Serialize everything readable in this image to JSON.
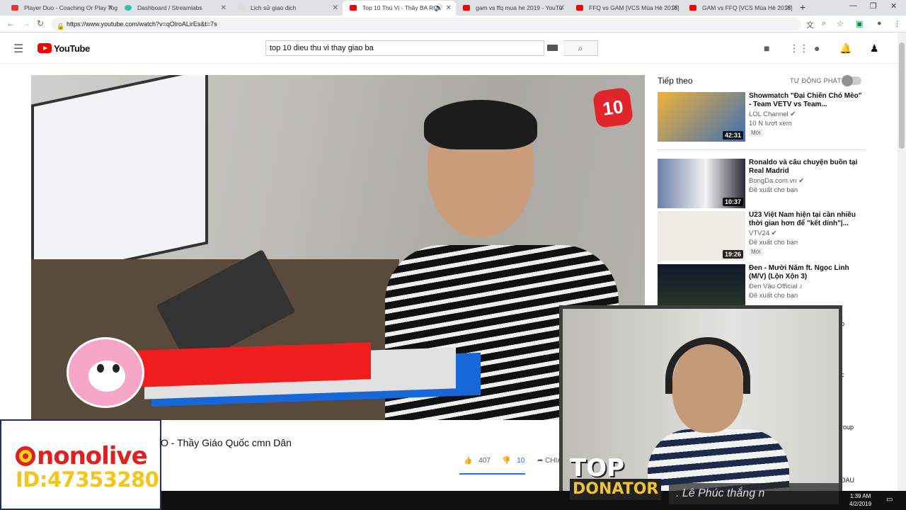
{
  "browser": {
    "tabs": [
      {
        "label": "Player Duo - Coaching Or Play Tog",
        "icon": "playerduo-icon",
        "color": "#e33"
      },
      {
        "label": "Dashboard / Streamlabs",
        "icon": "streamlabs-icon",
        "color": "#31c3a2"
      },
      {
        "label": "Lịch sử giao dịch",
        "icon": "page-icon",
        "color": "#ccc"
      },
      {
        "label": "Top 10 Thú Vị - Thầy BA RO",
        "icon": "youtube-icon",
        "color": "#ff0000",
        "active": true
      },
      {
        "label": "gam vs ffq mua he 2019 - YouTu",
        "icon": "youtube-icon",
        "color": "#ff0000"
      },
      {
        "label": "FFQ vs GAM [VCS Mùa Hè 2018]",
        "icon": "youtube-icon",
        "color": "#ff0000"
      },
      {
        "label": "GAM vs FFQ [VCS Mùa Hè 2018]",
        "icon": "youtube-icon",
        "color": "#ff0000"
      }
    ],
    "url": "https://www.youtube.com/watch?v=qOlroALirEs&t=7s"
  },
  "youtube": {
    "logo_text": "YouTube",
    "search_query": "top 10 dieu thu vi thay giao ba",
    "video_title_visible": "O - Thầy Giáo Quốc cmn Dân",
    "likes": "407",
    "dislikes": "10",
    "share_label": "CHIA"
  },
  "player": {
    "badge": "10"
  },
  "sidebar": {
    "up_next": "Tiếp theo",
    "autoplay": "TỰ ĐỘNG PHÁT",
    "videos": [
      {
        "title": "Showmatch \"Đại Chiến Chó Mèo\" - Team VETV vs Team...",
        "channel": "LOL Channel",
        "meta": "10 N lượt xem",
        "badge": "Mới",
        "duration": "42:31",
        "thumb_color": "#f0b23a"
      },
      {
        "title": "Ronaldo và câu chuyện buồn tại Real Madrid",
        "channel": "BongDa.com.vn",
        "meta": "Đề xuất cho bạn",
        "badge": "",
        "duration": "10:37",
        "thumb_color": "#6b7fa8"
      },
      {
        "title": "U23 Việt Nam hiện tại cần nhiều thời gian hơn để \"kết dính\"|...",
        "channel": "VTV24",
        "meta": "Đề xuất cho bạn",
        "badge": "Mới",
        "duration": "19:26",
        "thumb_color": "#e9e6df"
      },
      {
        "title": "Đen - Mười Năm ft. Ngọc Linh (M/V) (Lộn Xộn 3)",
        "channel": "Đen Vâu Official ♪",
        "meta": "Đề xuất cho bạn",
        "badge": "",
        "duration": "",
        "thumb_color": "#0f1a2a"
      }
    ],
    "partial_texts": [
      "p",
      "c",
      "roup",
      "ĐAU"
    ]
  },
  "webcam": {
    "top_label": "TOP",
    "donator_label": "DONATOR",
    "donator_name": ". Lê Phúc thắng n"
  },
  "nonolive": {
    "brand": "nonolive",
    "id_text": "ID:47353280"
  },
  "taskbar": {
    "time": "1:39 AM",
    "date": "4/2/2019"
  }
}
